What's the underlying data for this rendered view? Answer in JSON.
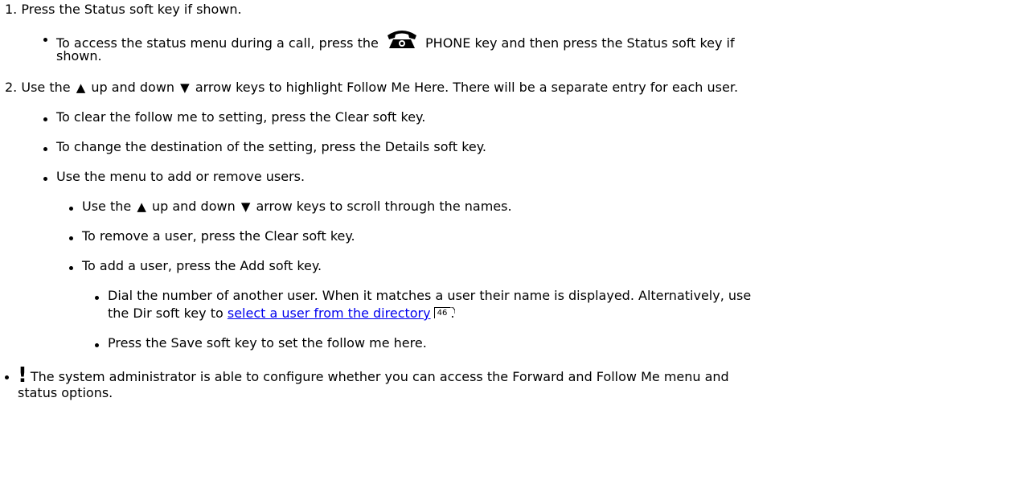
{
  "steps": [
    {
      "number": "1.",
      "text": "Press the Status soft key if shown."
    },
    {
      "number": "2.",
      "text_before": "Use the",
      "text_middle": "up and down",
      "text_after": "arrow keys to highlight Follow Me Here. There will be a separate entry for each user."
    }
  ],
  "sub1": {
    "before": "To access the status menu during a call, press the",
    "after": "PHONE key and then press the Status soft key if",
    "cont": "shown."
  },
  "sub2": [
    "To clear the follow me to setting, press the Clear soft key.",
    "To change the destination of the setting, press the Details soft key.",
    "Use the menu to add or remove users."
  ],
  "sub3": {
    "scroll_before": "Use the",
    "scroll_middle": "up and down",
    "scroll_after": "arrow keys to scroll through the names.",
    "remove": "To remove a user, press the Clear soft key.",
    "add": "To add a user, press the Add soft key."
  },
  "sub4": {
    "dial_line1": "Dial the number of another user. When it matches a user their name is displayed.  Alternatively, use",
    "dial_line2_before": "the Dir soft key to",
    "dial_link": "select a user from the directory",
    "page_ref": "46",
    "dial_line2_after": ".",
    "save": "Press the Save soft key to set the follow me here."
  },
  "note": {
    "icon": "!",
    "line1": "The system administrator is able to configure whether you can access the Forward and Follow Me menu and",
    "line2": "status options."
  },
  "icons": {
    "phone": "phone-key-icon",
    "up": "up-arrow-icon",
    "down": "down-arrow-icon",
    "warning": "exclamation-icon"
  }
}
